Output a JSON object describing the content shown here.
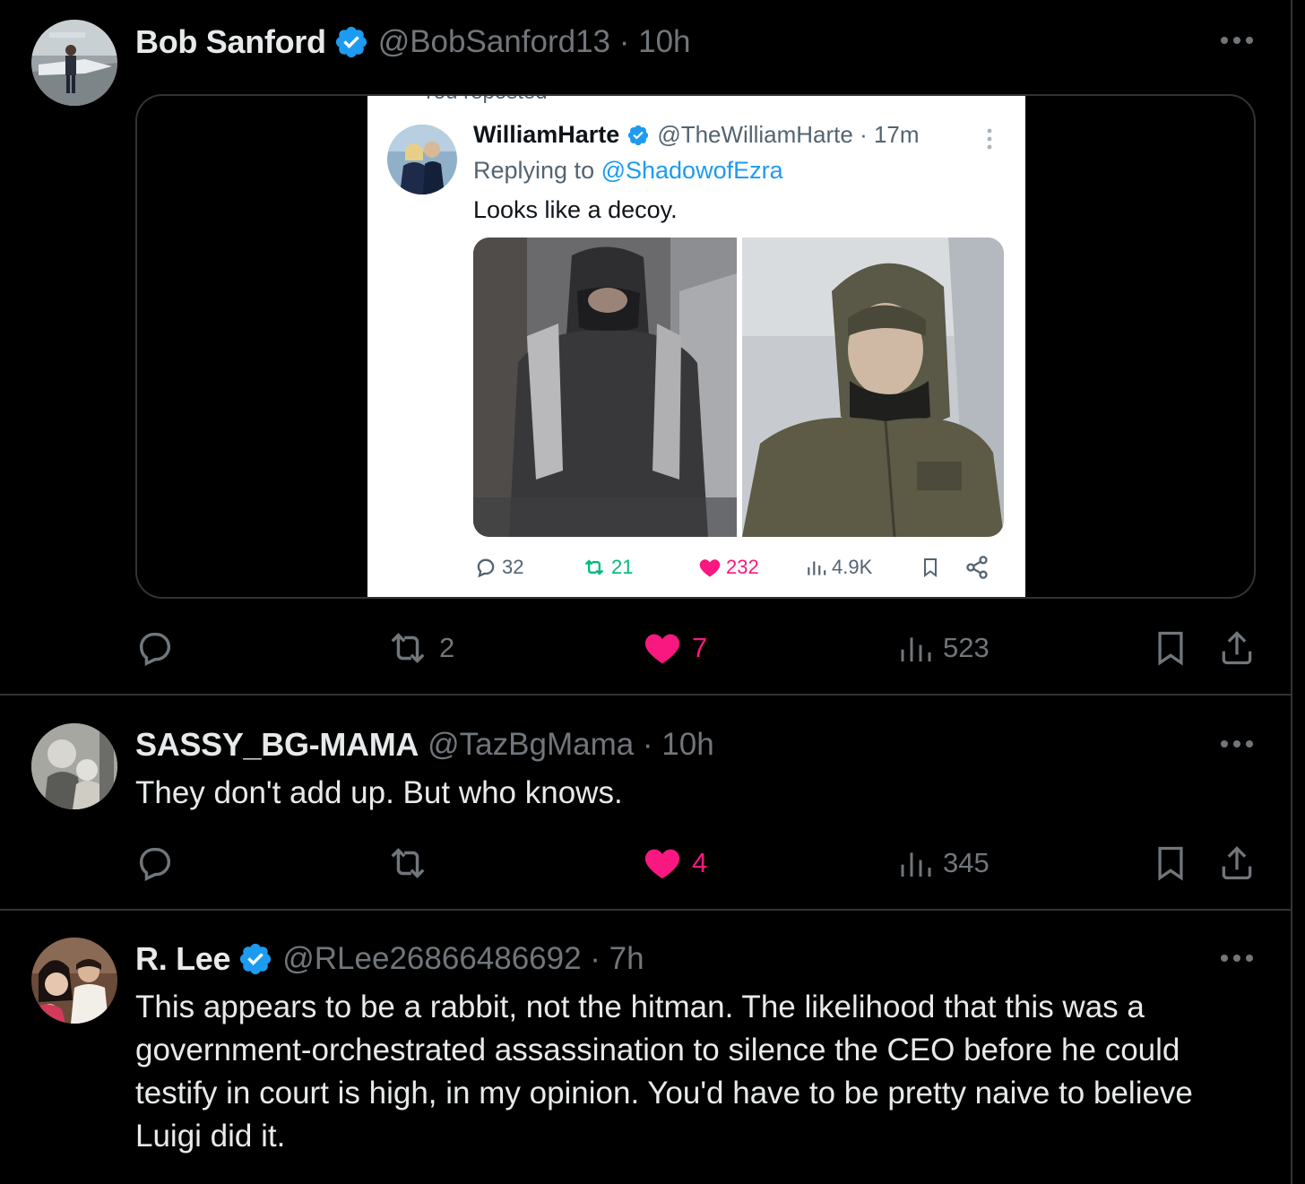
{
  "posts": [
    {
      "name": "Bob Sanford",
      "verified": true,
      "handle_time": "@BobSanford13 · 10h",
      "text": "",
      "embedded_screenshot": {
        "cut_header": "You reposted",
        "name": "WilliamHarte",
        "verified": true,
        "handle_time": "@TheWilliamHarte · 17m",
        "replying_prefix": "Replying to ",
        "replying_handle": "@ShadowofEzra",
        "text": "Looks like a decoy.",
        "stats": {
          "replies": "32",
          "reposts": "21",
          "likes": "232",
          "views": "4.9K"
        },
        "colors": {
          "repost": "#00ba7c",
          "like": "#f91880",
          "link": "#1d9bf0"
        }
      },
      "stats": {
        "replies": "",
        "reposts": "2",
        "likes": "7",
        "views": "523"
      }
    },
    {
      "name": "SASSY_BG-MAMA",
      "verified": false,
      "handle_time": "@TazBgMama · 10h",
      "text": "They don't add up. But who knows.",
      "stats": {
        "replies": "",
        "reposts": "",
        "likes": "4",
        "views": "345"
      }
    },
    {
      "name": "R. Lee",
      "verified": true,
      "handle_time": "@RLee26866486692 · 7h",
      "text": "This appears to be a rabbit, not the hitman. The likelihood that this was a government-orchestrated assassination to silence the CEO before he could testify in court is high, in my opinion. You'd have to be pretty naive to believe Luigi did it."
    }
  ],
  "colors": {
    "background": "#000000",
    "text": "#e7e9ea",
    "muted": "#71767b",
    "like": "#f91880",
    "verified": "#1d9bf0",
    "divider": "#2f3336"
  },
  "icons": [
    "reply-icon",
    "repost-icon",
    "like-icon",
    "views-icon",
    "bookmark-icon",
    "share-icon",
    "more-icon",
    "verified-icon"
  ]
}
